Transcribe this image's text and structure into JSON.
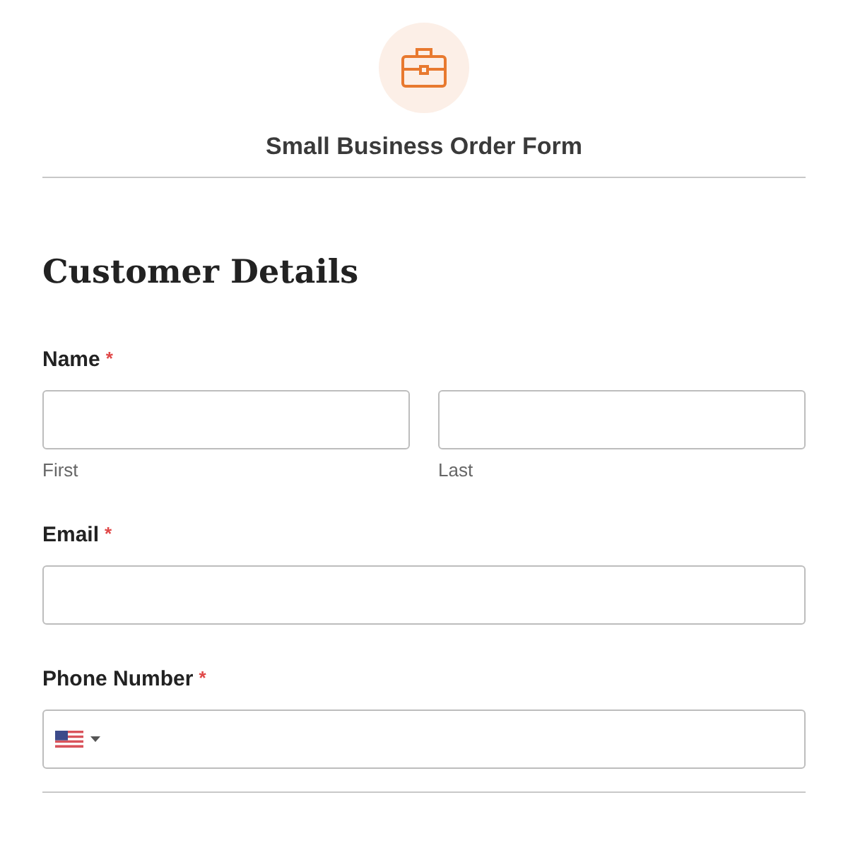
{
  "form": {
    "title": "Small Business Order Form"
  },
  "section": {
    "heading": "Customer Details"
  },
  "fields": [
    {
      "kind": "name",
      "label": "Name",
      "required_mark": "*",
      "sublabels": [
        "First",
        "Last"
      ]
    },
    {
      "kind": "text",
      "label": "Email",
      "required_mark": "*"
    },
    {
      "kind": "phone",
      "label": "Phone Number",
      "required_mark": "*"
    }
  ]
}
